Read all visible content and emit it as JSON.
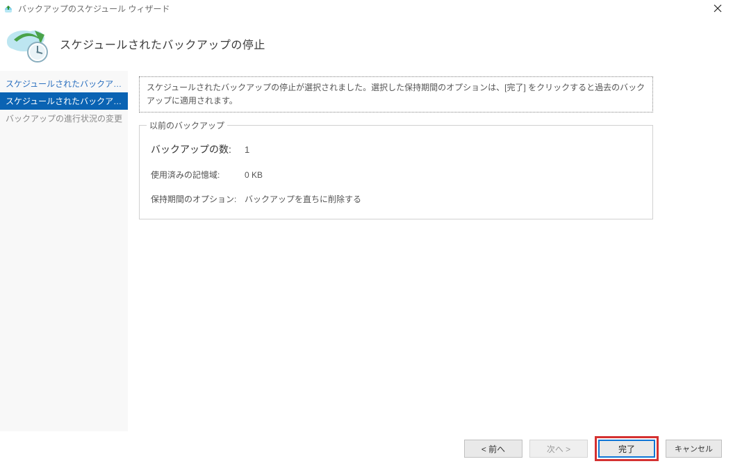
{
  "window": {
    "title": "バックアップのスケジュール ウィザード"
  },
  "header": {
    "heading": "スケジュールされたバックアップの停止"
  },
  "sidebar": {
    "items": [
      {
        "label": "スケジュールされたバックアップを変...",
        "state": "completed"
      },
      {
        "label": "スケジュールされたバックアップの停",
        "state": "current"
      },
      {
        "label": "バックアップの進行状況の変更",
        "state": "future"
      }
    ]
  },
  "main": {
    "info_text": "スケジュールされたバックアップの停止が選択されました。選択した保持期間のオプションは、[完了] をクリックすると過去のバックアップに適用されます。",
    "group_legend": "以前のバックアップ",
    "rows": {
      "count": {
        "label": "バックアップの数:",
        "value": "1"
      },
      "storage": {
        "label": "使用済みの記憶域:",
        "value": "0 KB"
      },
      "retain": {
        "label": "保持期間のオプション:",
        "value": "バックアップを直ちに削除する"
      }
    }
  },
  "footer": {
    "back": "< 前へ",
    "next": "次へ >",
    "finish": "完了",
    "cancel": "キャンセル"
  }
}
